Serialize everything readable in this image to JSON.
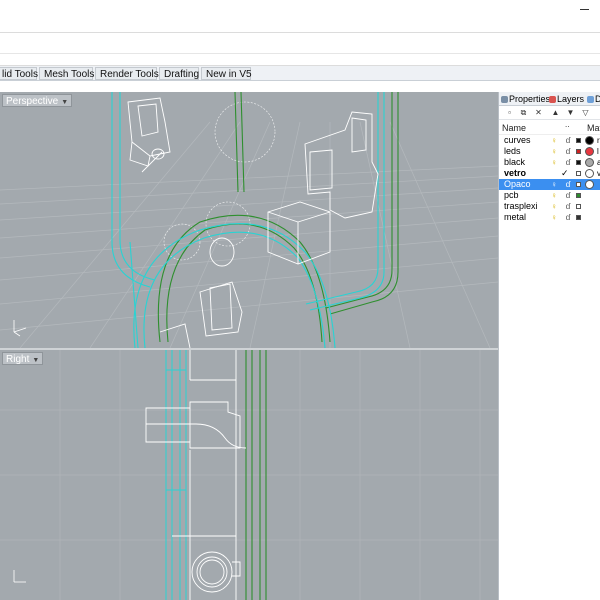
{
  "toolbar_tabs": [
    "lid Tools",
    "Mesh Tools",
    "Render Tools",
    "Drafting",
    "New in V5"
  ],
  "viewports": {
    "perspective_label": "Perspective",
    "right_label": "Right"
  },
  "panel": {
    "tabs": [
      "Properties",
      "Layers",
      "D"
    ],
    "columns": {
      "name": "Name",
      "material": "Mat"
    },
    "layers": [
      {
        "name": "curves",
        "color": "#111111",
        "material_color": "#000000",
        "material_text": "r"
      },
      {
        "name": "leds",
        "color": "#cc2222",
        "material_color": "#e8373f",
        "material_text": "l"
      },
      {
        "name": "black",
        "color": "#111111",
        "material_color": "#a9a9a9",
        "material_text": "a"
      },
      {
        "name": "vetro",
        "color": "#ffffff",
        "material_color": "#ffffff",
        "material_text": "v"
      },
      {
        "name": "Opaco",
        "color": "#ffffff",
        "material_color": "#ffffff",
        "material_text": ""
      },
      {
        "name": "pcb",
        "color": "#2e8b2e",
        "material_color": "",
        "material_text": ""
      },
      {
        "name": "trasplexi",
        "color": "#ffffff",
        "material_color": "",
        "material_text": ""
      },
      {
        "name": "metal",
        "color": "#333333",
        "material_color": "",
        "material_text": ""
      }
    ],
    "current_layer": "vetro",
    "selected_layer": "Opaco"
  },
  "colors": {
    "viewport_bg": "#a3a9ae",
    "grid": "#b3b8bc",
    "curve_white": "#ffffff",
    "curve_cyan": "#29d3d3",
    "curve_green": "#2f8f2f",
    "selection_blue": "#3b8ff0"
  }
}
